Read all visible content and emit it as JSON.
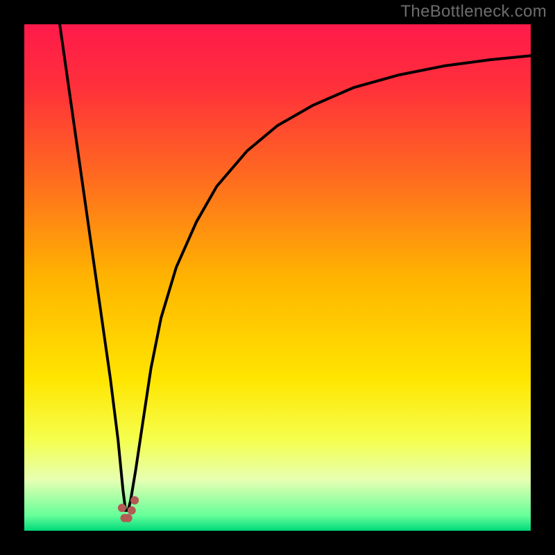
{
  "watermark": {
    "text": "TheBottleneck.com"
  },
  "chart_data": {
    "type": "line",
    "title": "",
    "xlabel": "",
    "ylabel": "",
    "xlim": [
      0,
      100
    ],
    "ylim": [
      0,
      100
    ],
    "grid": false,
    "legend": false,
    "background_gradient_stops": [
      {
        "offset": 0.0,
        "color": "#ff1a4b"
      },
      {
        "offset": 0.12,
        "color": "#ff2f3b"
      },
      {
        "offset": 0.3,
        "color": "#ff6a20"
      },
      {
        "offset": 0.5,
        "color": "#ffb400"
      },
      {
        "offset": 0.7,
        "color": "#ffe500"
      },
      {
        "offset": 0.82,
        "color": "#f5ff4d"
      },
      {
        "offset": 0.9,
        "color": "#e6ffb3"
      },
      {
        "offset": 0.97,
        "color": "#66ff99"
      },
      {
        "offset": 1.0,
        "color": "#00d97a"
      }
    ],
    "series": [
      {
        "name": "bottleneck-curve",
        "stroke": "#000000",
        "x": [
          7,
          9,
          11,
          13,
          15,
          17,
          18.5,
          19.5,
          20,
          20.5,
          21,
          22,
          23.5,
          25,
          27,
          30,
          34,
          38,
          44,
          50,
          57,
          65,
          74,
          83,
          92,
          100
        ],
        "y": [
          100,
          86,
          72,
          58,
          44,
          30,
          18,
          8,
          4,
          4,
          6,
          12,
          22,
          32,
          42,
          52,
          61,
          68,
          75,
          80,
          84,
          87.5,
          90,
          91.8,
          93,
          93.8
        ]
      }
    ],
    "marker": {
      "name": "valley-marker",
      "color": "#b35a55",
      "points": [
        {
          "x": 19.3,
          "y": 4.5,
          "r": 6
        },
        {
          "x": 19.8,
          "y": 2.5,
          "r": 6
        },
        {
          "x": 20.5,
          "y": 2.5,
          "r": 6
        },
        {
          "x": 21.2,
          "y": 4.0,
          "r": 6
        },
        {
          "x": 21.8,
          "y": 6.0,
          "r": 6
        }
      ]
    }
  }
}
